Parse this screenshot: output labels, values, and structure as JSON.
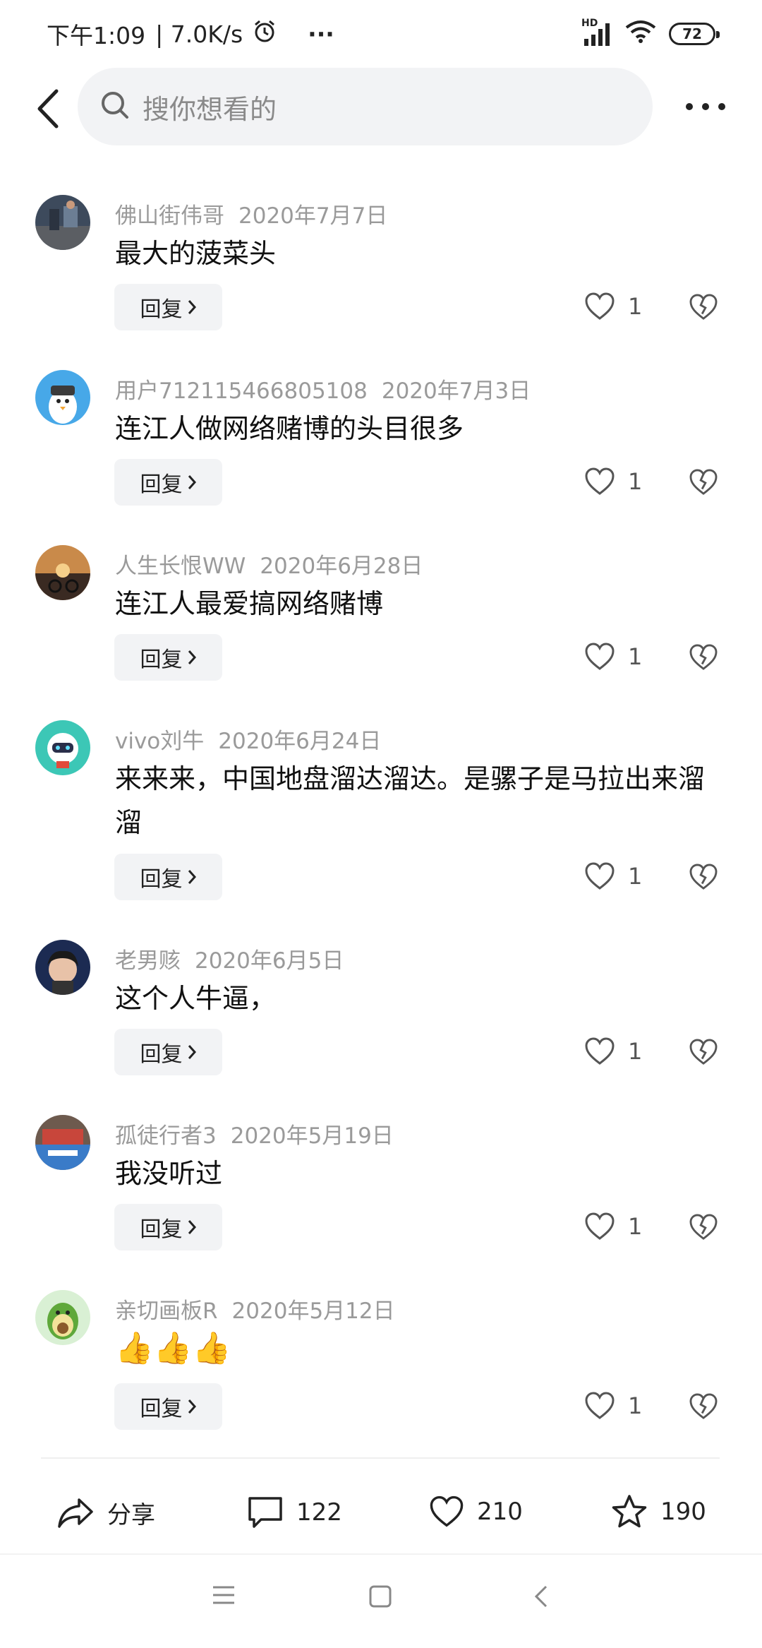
{
  "status_bar": {
    "time": "下午1:09",
    "speed": "| 7.0K/s",
    "more": "···",
    "signal_label": "HD",
    "battery": "72"
  },
  "header": {
    "search_placeholder": "搜你想看的"
  },
  "reply_label": "回复",
  "comments": [
    {
      "user": "佛山街伟哥",
      "date": "2020年7月7日",
      "text": "最大的菠菜头",
      "likes": "1"
    },
    {
      "user": "用户712115466805108",
      "date": "2020年7月3日",
      "text": "连江人做网络赌博的头目很多",
      "likes": "1"
    },
    {
      "user": "人生长恨WW",
      "date": "2020年6月28日",
      "text": "连江人最爱搞网络赌博",
      "likes": "1"
    },
    {
      "user": "vivo刘牛",
      "date": "2020年6月24日",
      "text": "来来来，中国地盘溜达溜达。是骡子是马拉出来溜溜",
      "likes": "1"
    },
    {
      "user": "老男赅",
      "date": "2020年6月5日",
      "text": "这个人牛逼，",
      "likes": "1"
    },
    {
      "user": "孤徒行者3",
      "date": "2020年5月19日",
      "text": "我没听过",
      "likes": "1"
    },
    {
      "user": "亲切画板R",
      "date": "2020年5月12日",
      "text": "👍👍👍",
      "likes": "1"
    }
  ],
  "actions": {
    "share_label": "分享",
    "comment_count": "122",
    "like_count": "210",
    "favorite_count": "190"
  }
}
